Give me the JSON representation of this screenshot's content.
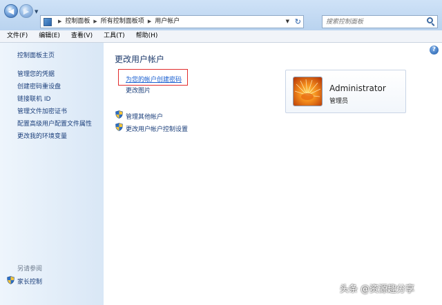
{
  "nav": {
    "back_glyph": "◀",
    "forward_glyph": "▶",
    "breadcrumb": [
      "控制面板",
      "所有控制面板项",
      "用户帐户"
    ],
    "search_placeholder": "搜索控制面板"
  },
  "menu": [
    "文件(F)",
    "编辑(E)",
    "查看(V)",
    "工具(T)",
    "帮助(H)"
  ],
  "sidebar": {
    "home": "控制面板主页",
    "links": [
      "管理您的凭据",
      "创建密码重设盘",
      "链接联机 ID",
      "管理文件加密证书",
      "配置高级用户配置文件属性",
      "更改我的环境变量"
    ],
    "see_also": "另请参阅",
    "family": "家长控制"
  },
  "main": {
    "title": "更改用户帐户",
    "create_password": "为您的帐户创建密码",
    "change_picture": "更改图片",
    "manage_accounts": "管理其他帐户",
    "uac_settings": "更改用户帐户控制设置"
  },
  "user": {
    "name": "Administrator",
    "role": "管理员"
  },
  "watermark": "头条 @资源趣分享",
  "colors": {
    "link": "#1a3e7a",
    "highlight_border": "#e12b2b",
    "sidebar_bg": "#d9e7f6"
  },
  "icons": {
    "help": "?",
    "refresh": "↻",
    "dropdown": "▼"
  }
}
